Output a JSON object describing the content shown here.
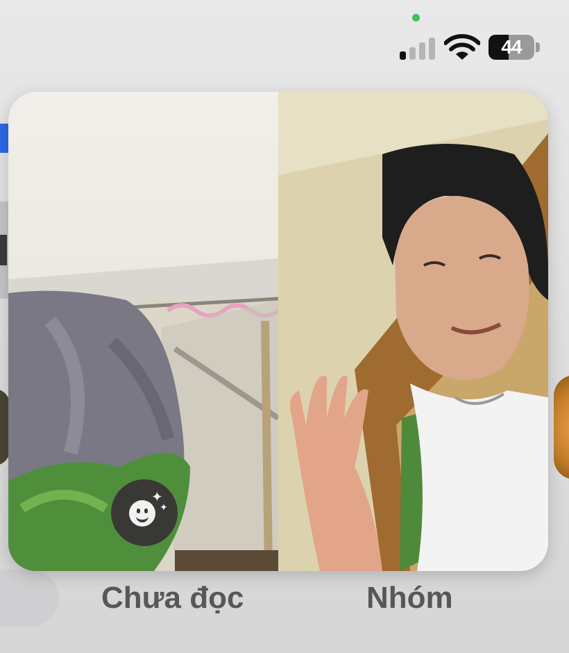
{
  "status_bar": {
    "battery_level": "44",
    "battery_fraction": 0.44,
    "signal_bars_on": 1,
    "signal_bars_total": 4,
    "icons": [
      "privacy-indicator-dot",
      "cellular-signal-icon",
      "wifi-icon",
      "battery-icon"
    ],
    "privacy_dot_color": "#3ec25a"
  },
  "video_call": {
    "left_feed": "self-camera-view",
    "right_feed": "remote-participant-view",
    "effects_button_icon": "smiley-sparkle-icon"
  },
  "tabs": {
    "unread_label": "Chưa đọc",
    "groups_label": "Nhóm"
  },
  "colors": {
    "accent_blue": "#2a6ae8",
    "tab_text": "#575759",
    "background": "#e2e2e3"
  }
}
